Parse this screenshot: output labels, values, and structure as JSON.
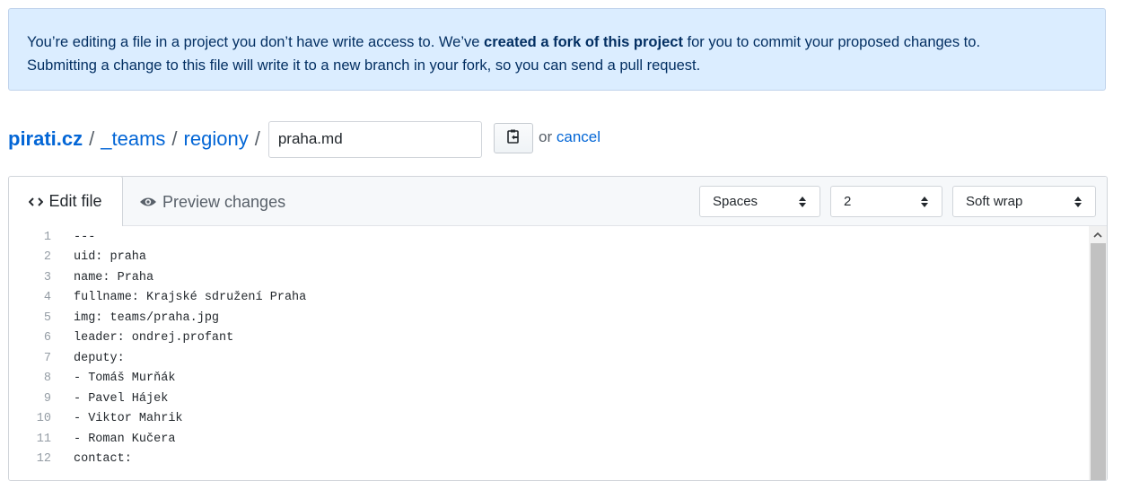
{
  "flash": {
    "part1": "You’re editing a file in a project you don’t have write access to. We’ve ",
    "bold": "created a fork of this project",
    "part2": " for you to commit your proposed changes to.",
    "line2": "Submitting a change to this file will write it to a new branch in your fork, so you can send a pull request."
  },
  "breadcrumb": {
    "root": "pirati.cz",
    "separator": "/",
    "items": [
      "_teams",
      "regiony"
    ]
  },
  "filename": {
    "value": "praha.md"
  },
  "actions": {
    "or_text": "or",
    "cancel_label": "cancel"
  },
  "editor": {
    "tabs": {
      "edit": "Edit file",
      "preview": "Preview changes"
    },
    "indent_mode": "Spaces",
    "indent_size": "2",
    "wrap_mode": "Soft wrap",
    "lines": [
      {
        "n": "1",
        "text": "---"
      },
      {
        "n": "2",
        "text": "uid: praha"
      },
      {
        "n": "3",
        "text": "name: Praha"
      },
      {
        "n": "4",
        "text": "fullname: Krajské sdružení Praha"
      },
      {
        "n": "5",
        "text": "img: teams/praha.jpg"
      },
      {
        "n": "6",
        "text": "leader: ondrej.profant"
      },
      {
        "n": "7",
        "text": "deputy:"
      },
      {
        "n": "8",
        "text": "- Tomáš Murňák"
      },
      {
        "n": "9",
        "text": "- Pavel Hájek"
      },
      {
        "n": "10",
        "text": "- Viktor Mahrik"
      },
      {
        "n": "11",
        "text": "- Roman Kučera"
      },
      {
        "n": "12",
        "text": "contact:"
      }
    ]
  },
  "colors": {
    "link": "#0366d6",
    "flash_bg": "#dbedff",
    "flash_text": "#032f62"
  }
}
